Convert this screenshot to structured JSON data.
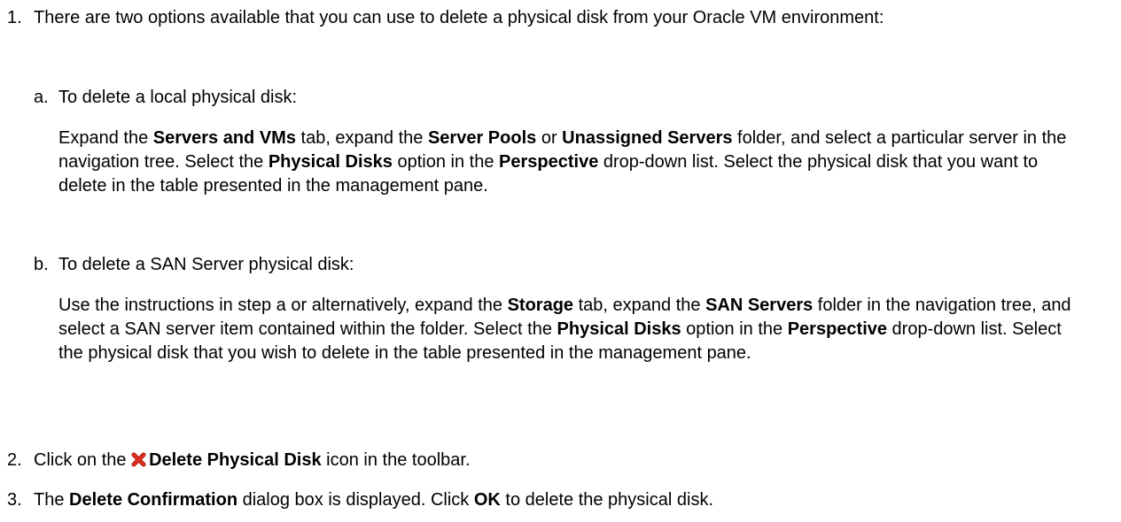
{
  "steps": [
    {
      "num": "1.",
      "intro": "There are two options available that you can use to delete a physical disk from your Oracle VM environment:",
      "options": [
        {
          "letter": "a.",
          "heading": "To delete a local physical disk:",
          "body": {
            "t1": "Expand the ",
            "b1": "Servers and VMs",
            "t2": " tab, expand the ",
            "b2": "Server Pools",
            "t3": " or ",
            "b3": "Unassigned Servers",
            "t4": " folder, and select a particular server in the navigation tree. Select the ",
            "b4": "Physical Disks",
            "t5": " option in the ",
            "b5": "Perspective",
            "t6": " drop-down list. Select the physical disk that you want to delete in the table presented in the management pane."
          }
        },
        {
          "letter": "b.",
          "heading": "To delete a SAN Server physical disk:",
          "body": {
            "t1": "Use the instructions in step a or alternatively, expand the ",
            "b1": "Storage",
            "t2": " tab, expand the ",
            "b2": "SAN Servers",
            "t3": " folder in the navigation tree, and select a SAN server item contained within the folder. Select the ",
            "b3": "Physical Disks",
            "t4": " option in the ",
            "b4": "Perspective",
            "t5": " drop-down list. Select the physical disk that you wish to delete in the table presented in the management pane."
          }
        }
      ]
    },
    {
      "num": "2.",
      "t1": "Click on the ",
      "icon": "delete-x-icon",
      "b1": "Delete Physical Disk",
      "t2": " icon in the toolbar."
    },
    {
      "num": "3.",
      "t1": "The ",
      "b1": "Delete Confirmation",
      "t2": " dialog box is displayed. Click ",
      "b2": "OK",
      "t3": " to delete the physical disk."
    }
  ],
  "colors": {
    "text": "#000000",
    "icon_red": "#e0301e",
    "icon_dark": "#b01a10"
  }
}
